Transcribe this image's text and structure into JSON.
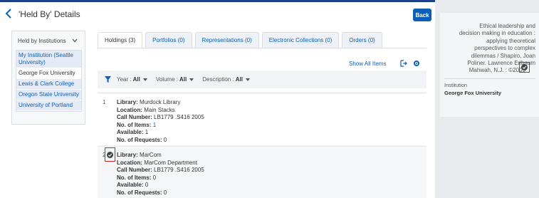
{
  "header": {
    "title": "'Held By' Details",
    "back_label": "Back"
  },
  "institutions": {
    "dropdown_label": "Held by Institutions",
    "items": [
      "My Institution (Seattle University)",
      "George Fox University",
      "Lewis & Clark College",
      "Oregon State University",
      "University of Portland"
    ]
  },
  "tabs": [
    "Holdings (3)",
    "Portfolios (0)",
    "Representations (0)",
    "Electronic Collections (0)",
    "Orders (0)"
  ],
  "toolbar": {
    "show_all": "Show All Items"
  },
  "filters": {
    "year_label": "Year :",
    "year_value": "All",
    "volume_label": "Volume :",
    "volume_value": "All",
    "description_label": "Description :",
    "description_value": "All"
  },
  "holdings": [
    {
      "num": "1",
      "library_label": "Library:",
      "library": "Murdock Library",
      "location_label": "Location:",
      "location": "Main Stacks",
      "call_label": "Call Number:",
      "call": "LB1779 .S416 2005",
      "items_label": "No. of Items:",
      "items": "1",
      "available_label": "Available:",
      "available": "1",
      "requests_label": "No. of Requests:",
      "requests": "0"
    },
    {
      "num": "2",
      "library_label": "Library:",
      "library": "MarCom",
      "location_label": "Location:",
      "location": "MarCom Department",
      "call_label": "Call Number:",
      "call": "LB1779 .S416 2005",
      "items_label": "No. of Items:",
      "items": "0",
      "available_label": "Available:",
      "available": "0",
      "requests_label": "No. of Requests:",
      "requests": "0"
    }
  ],
  "details": {
    "description_lines": [
      "Ethical leadership and",
      "decision making in education :",
      "applying theoretical",
      "perspectives to complex",
      "dilemmas / Shapiro, Joan",
      "Poliner. Lawrence Erlbaum",
      "Mahwah, N.J. : ©2005"
    ],
    "institution_label": "Institution",
    "institution_value": "George Fox University"
  },
  "colors": {
    "accent": "#0b5fb8",
    "topbar": "#1c3f8c",
    "highlight": "#dd2222"
  }
}
